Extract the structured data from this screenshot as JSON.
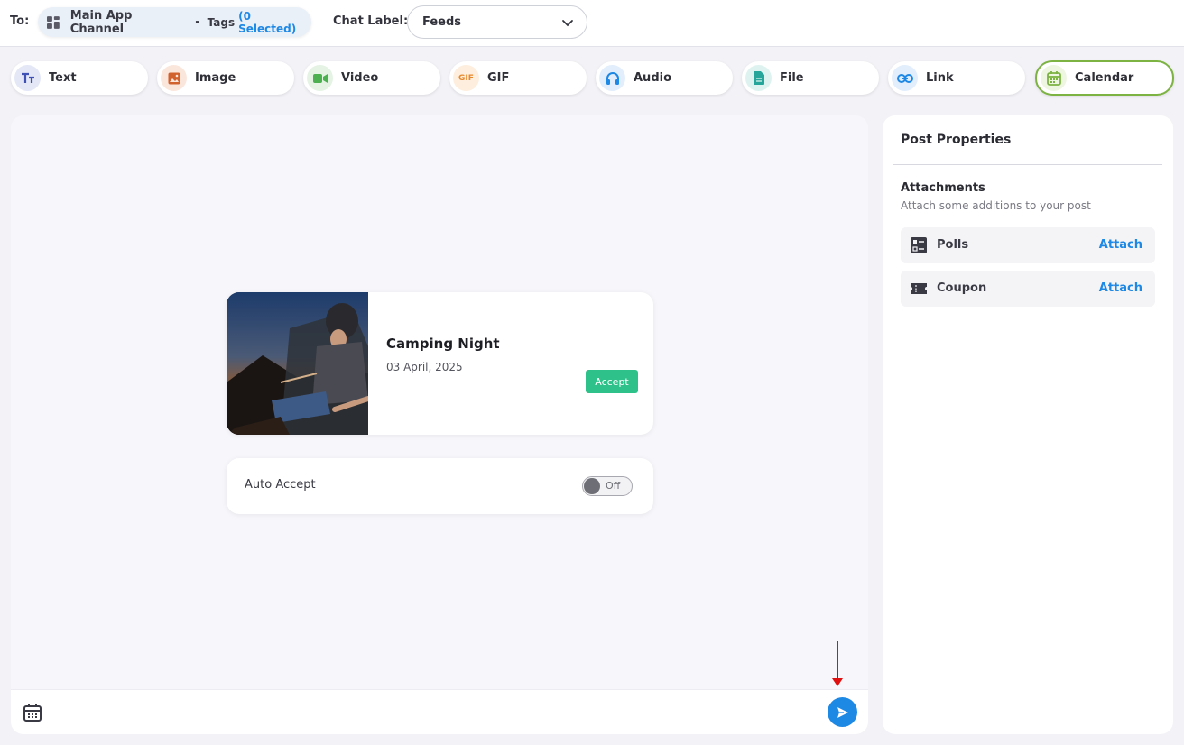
{
  "header": {
    "to_label": "To:",
    "channel_name": "Main App Channel",
    "separator": "-",
    "tags_label": "Tags",
    "tags_count": "(0 Selected)",
    "chat_label": "Chat Label:",
    "chat_label_value": "Feeds"
  },
  "tabs": [
    {
      "label": "Text",
      "icon": "text-format-icon",
      "color": "#3f51b5",
      "bg": "#e3e7f6"
    },
    {
      "label": "Image",
      "icon": "image-icon",
      "color": "#d2622d",
      "bg": "#fbe6dc"
    },
    {
      "label": "Video",
      "icon": "video-camera-icon",
      "color": "#4caf50",
      "bg": "#e4f3e4"
    },
    {
      "label": "GIF",
      "icon": "gif-icon",
      "color": "#e8892b",
      "bg": "#fdeede"
    },
    {
      "label": "Audio",
      "icon": "headphones-icon",
      "color": "#1e88e5",
      "bg": "#e2eefb"
    },
    {
      "label": "File",
      "icon": "file-icon",
      "color": "#26a69a",
      "bg": "#def3ef"
    },
    {
      "label": "Link",
      "icon": "link-icon",
      "color": "#1e88e5",
      "bg": "#e2eefb"
    },
    {
      "label": "Calendar",
      "icon": "calendar-icon",
      "color": "#7cb342",
      "bg": "#eef6e2",
      "active": true
    }
  ],
  "event": {
    "title": "Camping Night",
    "date": "03 April, 2025",
    "accept_label": "Accept"
  },
  "auto_accept": {
    "label": "Auto Accept",
    "toggle_state": "Off"
  },
  "post_properties": {
    "title": "Post Properties",
    "attachments_title": "Attachments",
    "attachments_subtitle": "Attach some additions to your post",
    "items": [
      {
        "name": "Polls",
        "action": "Attach",
        "icon": "poll-icon"
      },
      {
        "name": "Coupon",
        "action": "Attach",
        "icon": "coupon-icon"
      }
    ]
  },
  "colors": {
    "accent": "#1e88e5",
    "accept_green": "#2ec28a",
    "active_tab_border": "#7cb342",
    "annotation_arrow": "#e01010"
  }
}
